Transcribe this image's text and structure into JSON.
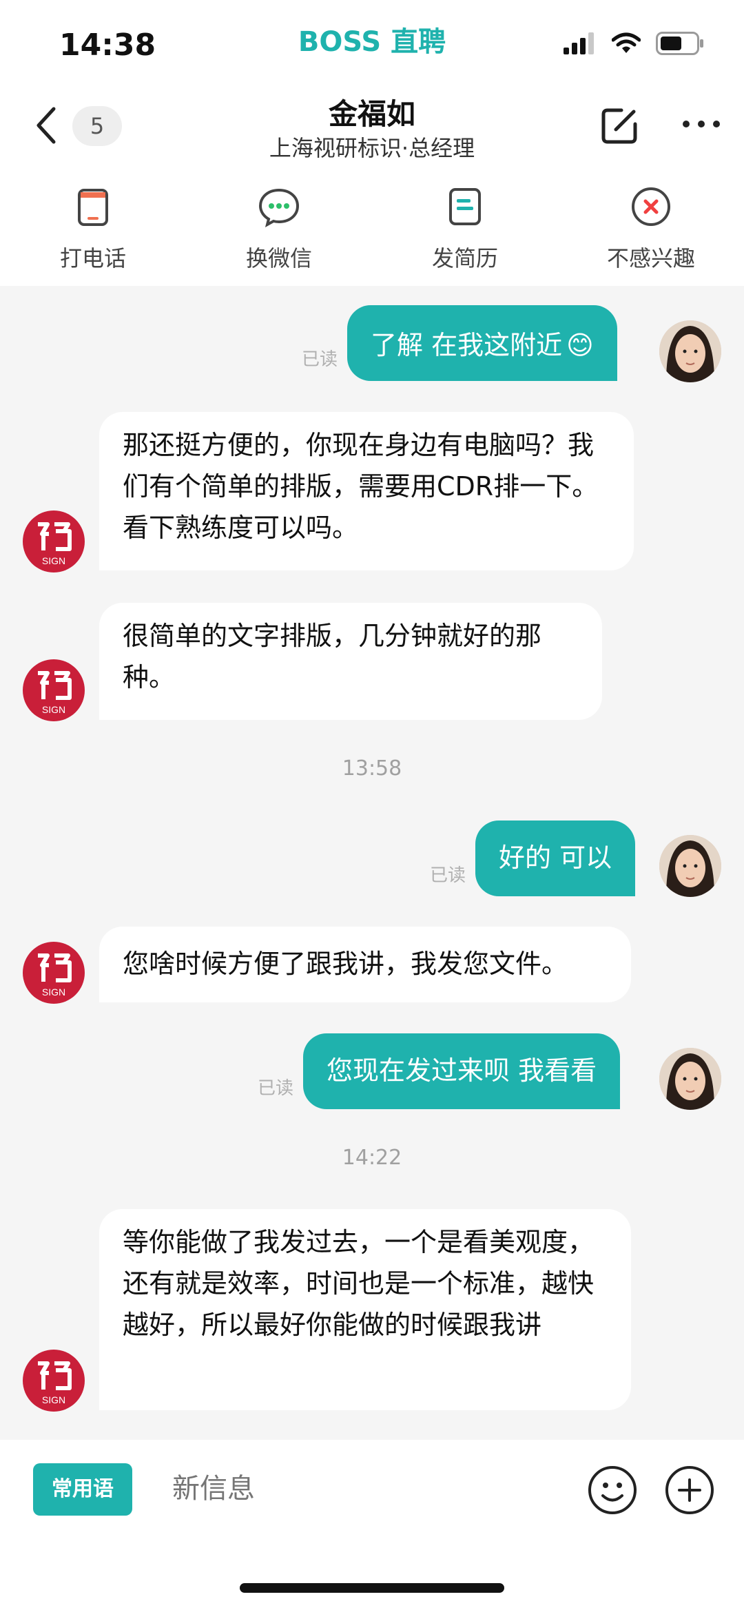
{
  "status_bar": {
    "time": "14:38",
    "brand": "BOSS 直聘"
  },
  "header": {
    "unread_count": "5",
    "contact_name": "金福如",
    "contact_title": "上海视研标识·总经理",
    "icons": [
      "back-chevron-icon",
      "edit-icon",
      "more-icon"
    ]
  },
  "actions": [
    {
      "label": "打电话",
      "icon": "phone-icon",
      "color": "#f07050"
    },
    {
      "label": "换微信",
      "icon": "wechat-icon",
      "color": "#2dbf6a"
    },
    {
      "label": "发简历",
      "icon": "resume-icon",
      "color": "#1fb2ad"
    },
    {
      "label": "不感兴趣",
      "icon": "not-interested-icon",
      "color": "#f04040"
    }
  ],
  "messages": [
    {
      "from": "me",
      "text": "了解 在我这附近",
      "emoji": "😊",
      "status": "已读"
    },
    {
      "from": "them",
      "text": "那还挺方便的，你现在身边有电脑吗？我们有个简单的排版，需要用CDR排一下。看下熟练度可以吗。"
    },
    {
      "from": "them",
      "text": "很简单的文字排版，几分钟就好的那种。"
    },
    {
      "timestamp": "13:58"
    },
    {
      "from": "me",
      "text": "好的 可以",
      "status": "已读"
    },
    {
      "from": "them",
      "text": "您啥时候方便了跟我讲，我发您文件。"
    },
    {
      "from": "me",
      "text": "您现在发过来呗 我看看",
      "status": "已读"
    },
    {
      "timestamp": "14:22"
    },
    {
      "from": "them",
      "text": "等你能做了我发过去，一个是看美观度，还有就是效率，时间也是一个标准，越快越好，所以最好你能做的时候跟我讲"
    }
  ],
  "company_logo_text": "SIGN",
  "input_bar": {
    "quick_phrases_label": "常用语",
    "placeholder": "新信息",
    "icons": [
      "emoji-icon",
      "plus-icon"
    ]
  },
  "colors": {
    "accent": "#1fb2ad",
    "logo_red": "#c91f39"
  }
}
